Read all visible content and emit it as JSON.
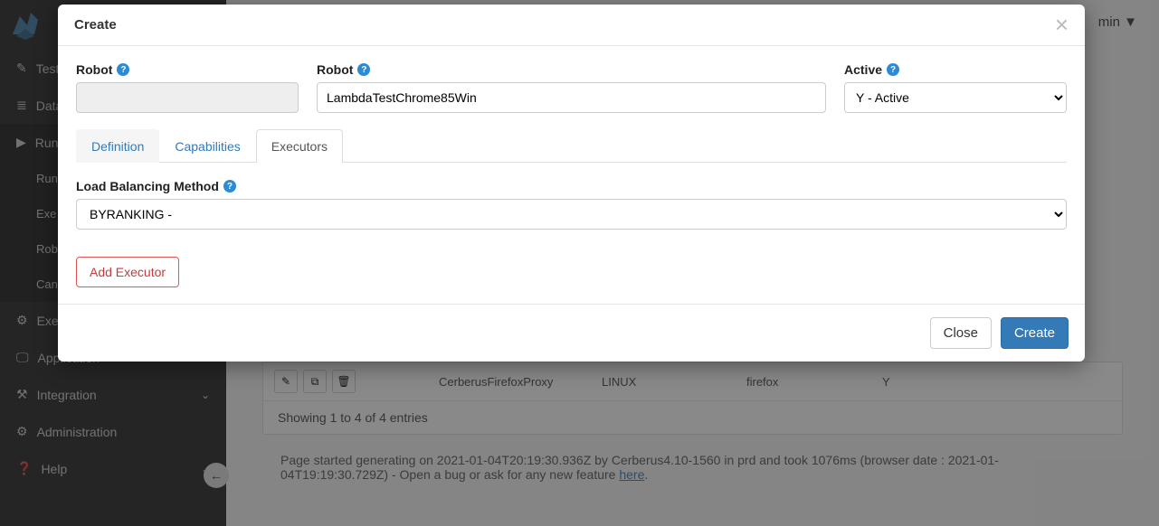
{
  "topbar": {
    "user_label": "min",
    "caret": "▼"
  },
  "sidebar": {
    "items": [
      {
        "icon": "edit-icon",
        "label": "Test"
      },
      {
        "icon": "database-icon",
        "label": "Data"
      },
      {
        "icon": "play-icon",
        "label": "Run",
        "expanded": true
      },
      {
        "icon": "gear-icon",
        "label": "Exec"
      },
      {
        "icon": "desktop-icon",
        "label": "Application"
      },
      {
        "icon": "integration-icon",
        "label": "Integration"
      },
      {
        "icon": "gears-icon",
        "label": "Administration"
      },
      {
        "icon": "question-icon",
        "label": "Help"
      }
    ],
    "run_subitems": [
      "Run",
      "Exe",
      "Rob",
      "Can"
    ]
  },
  "background": {
    "table": {
      "row": {
        "col1": "CerberusFirefoxProxy",
        "col2": "LINUX",
        "col3": "firefox",
        "col4": "Y"
      }
    },
    "showing": "Showing 1 to 4 of 4 entries",
    "footer_text_before": "Page started generating on 2021-01-04T20:19:30.936Z by Cerberus4.10-1560 in prd and took 1076ms (browser date : 2021-01-04T19:19:30.729Z) - Open a bug or ask for any new feature ",
    "footer_link": "here",
    "footer_text_after": "."
  },
  "modal": {
    "title": "Create",
    "robot1_label": "Robot",
    "robot1_value": "",
    "robot2_label": "Robot",
    "robot2_value": "LambdaTestChrome85Win",
    "active_label": "Active",
    "active_value": "Y - Active",
    "tabs": {
      "definition": "Definition",
      "capabilities": "Capabilities",
      "executors": "Executors"
    },
    "lbm_label": "Load Balancing Method",
    "lbm_value": "BYRANKING -",
    "add_executor": "Add Executor",
    "close": "Close",
    "create": "Create"
  }
}
